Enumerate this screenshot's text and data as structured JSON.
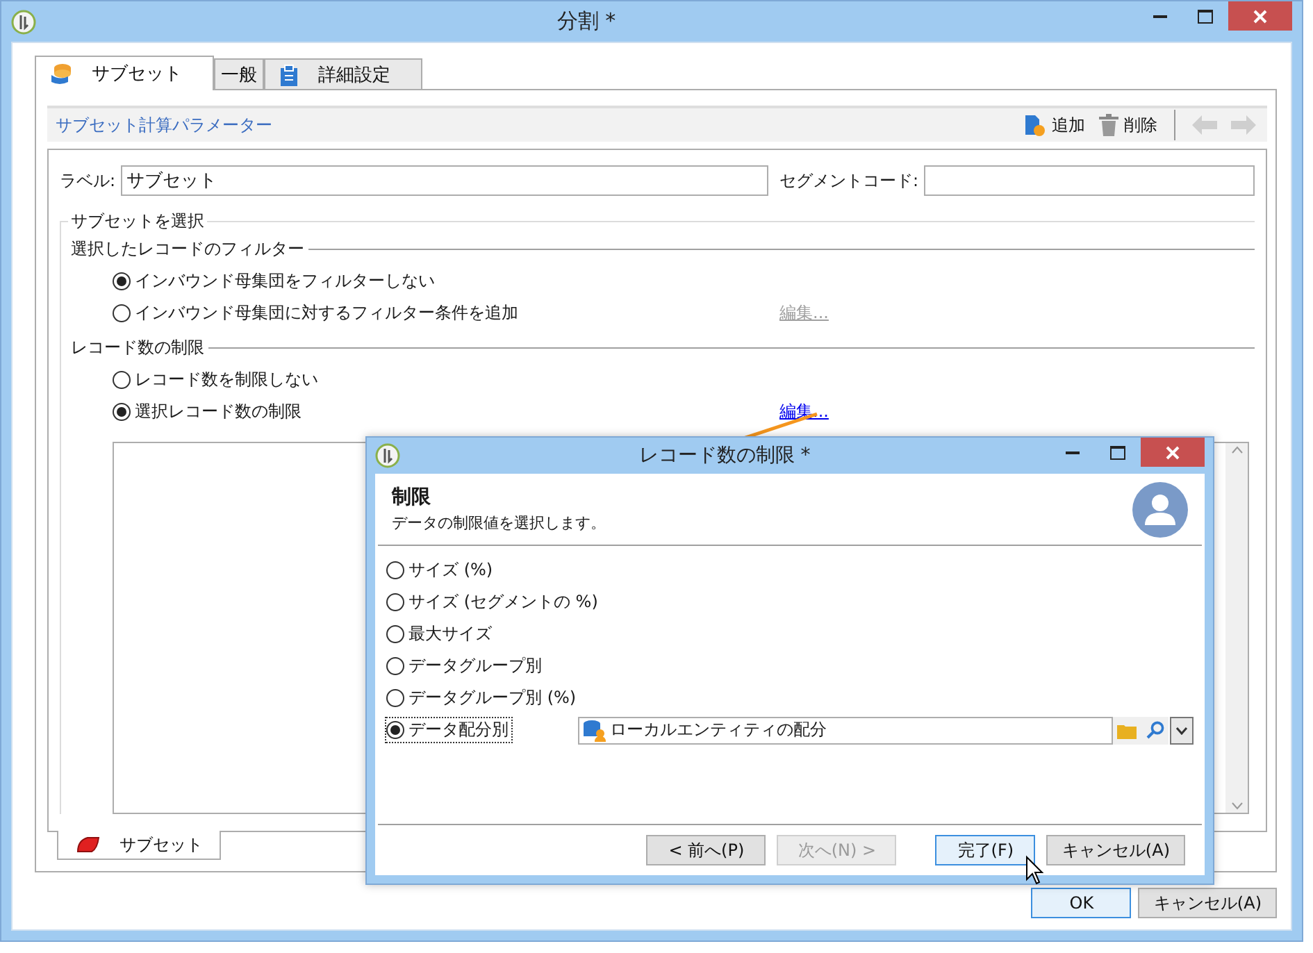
{
  "window": {
    "title": "分割 *"
  },
  "tabs": [
    {
      "label": "サブセット",
      "selected": true
    },
    {
      "label": "一般",
      "selected": false
    },
    {
      "label": "詳細設定",
      "selected": false
    }
  ],
  "toolbar": {
    "title": "サブセット計算パラメーター",
    "actions": [
      {
        "label": "追加"
      },
      {
        "label": "削除"
      }
    ],
    "nav": [
      {
        "disabled": true
      },
      {
        "disabled": true
      }
    ]
  },
  "form": {
    "label_caption": "ラベル:",
    "label_value": "サブセット",
    "segment_caption": "セグメントコード:"
  },
  "selection": {
    "title": "サブセットを選択",
    "sections": [
      {
        "title": "選択したレコードのフィルター",
        "options": [
          {
            "label": "インバウンド母集団をフィルターしない",
            "selected": true
          },
          {
            "label": "インバウンド母集団に対するフィルター条件を追加",
            "selected": false
          }
        ],
        "edit_link": {
          "label": "編集...",
          "disabled": true
        }
      },
      {
        "title": "レコード数の制限",
        "options": [
          {
            "label": "レコード数を制限しない",
            "selected": false
          },
          {
            "label": "選択レコード数の制限",
            "selected": true
          }
        ],
        "edit_link": {
          "label": "編集...",
          "disabled": false
        }
      }
    ]
  },
  "bottom_tabs": [
    {
      "label": "サブセット",
      "selected": true
    }
  ],
  "buttons": [
    {
      "label": "OK",
      "default": true
    },
    {
      "label": "キャンセル(A)",
      "default": false
    }
  ],
  "dialog": {
    "title": "レコード数の制限 *",
    "heading": "制限",
    "subtitle": "データの制限値を選択します。",
    "options": [
      {
        "label": "サイズ (%)",
        "selected": false,
        "focused": false
      },
      {
        "label": "サイズ (セグメントの %)",
        "selected": false,
        "focused": false
      },
      {
        "label": "最大サイズ",
        "selected": false,
        "focused": false
      },
      {
        "label": "データグループ別",
        "selected": false,
        "focused": false
      },
      {
        "label": "データグループ別 (%)",
        "selected": false,
        "focused": false
      },
      {
        "label": "データ配分別",
        "selected": true,
        "focused": true
      }
    ],
    "field": {
      "value": "ローカルエンティティの配分"
    },
    "buttons": [
      {
        "label": "< 前へ(P)",
        "disabled": false,
        "default": false
      },
      {
        "label": "次へ(N) >",
        "disabled": true,
        "default": false
      },
      {
        "label": "完了(F)",
        "disabled": false,
        "default": true
      },
      {
        "label": "キャンセル(A)",
        "disabled": false,
        "default": false
      }
    ]
  }
}
